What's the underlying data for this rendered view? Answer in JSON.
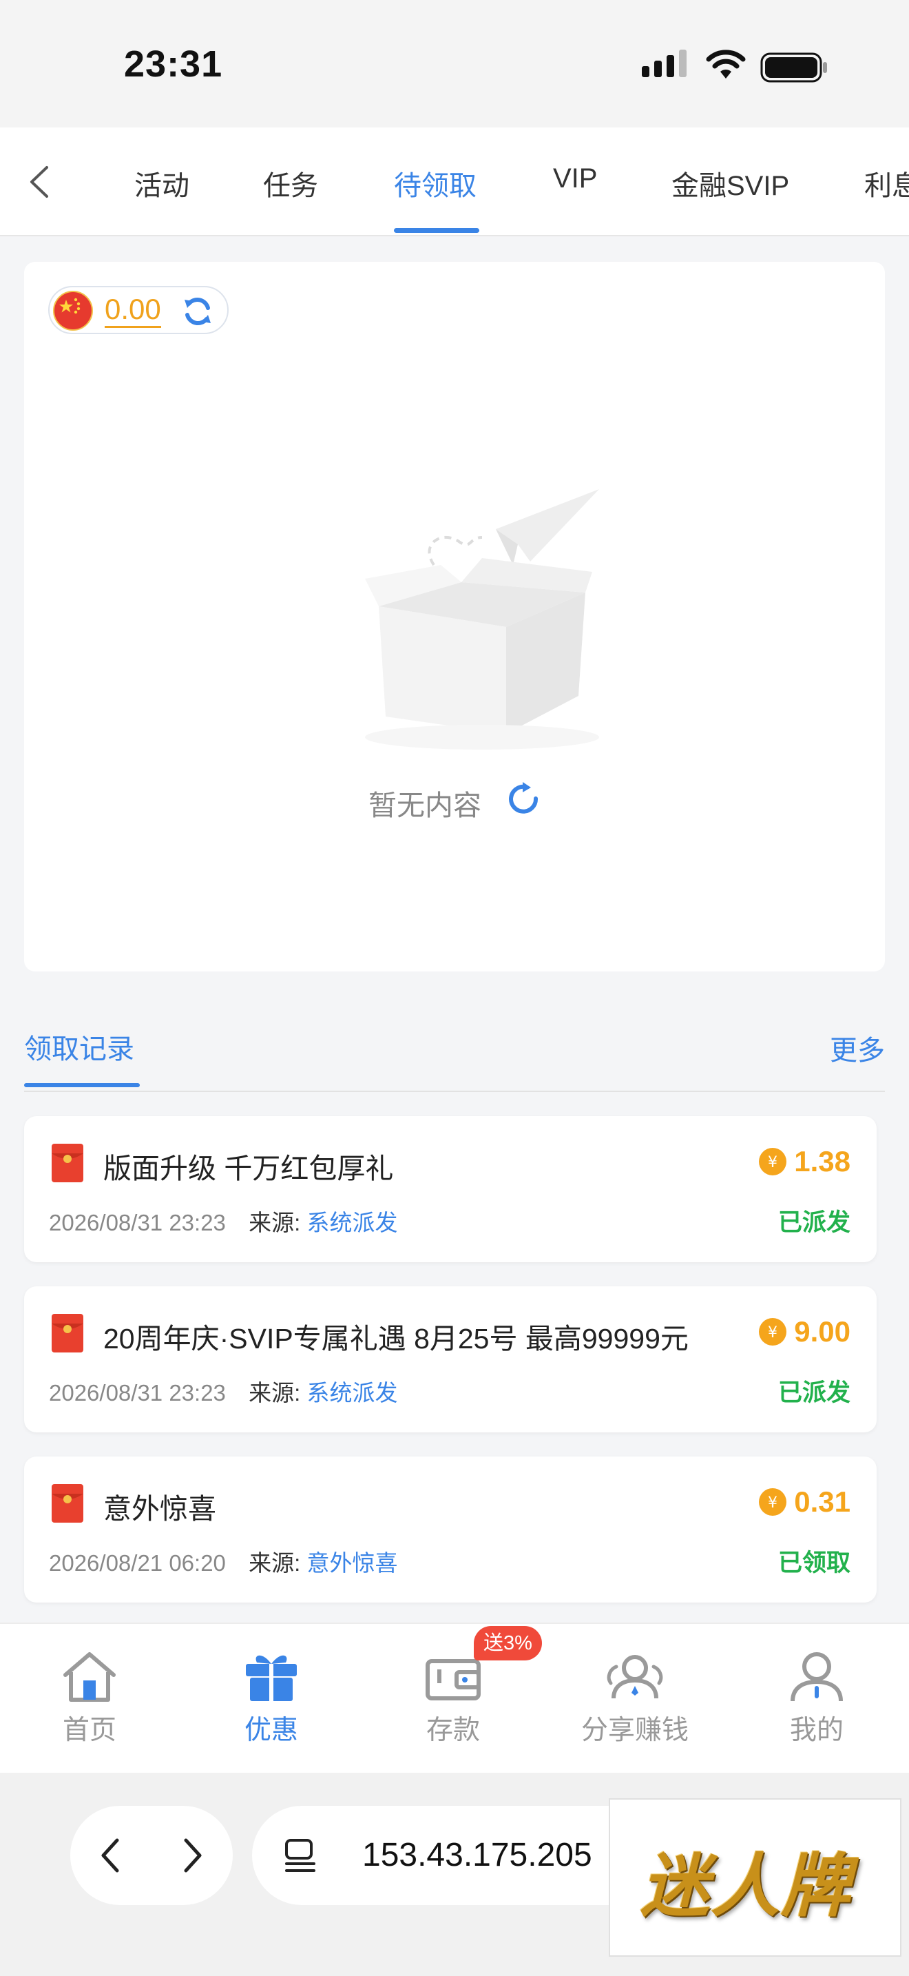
{
  "status_bar": {
    "time": "23:31"
  },
  "tabs": [
    {
      "label": "活动",
      "active": false
    },
    {
      "label": "任务",
      "active": false
    },
    {
      "label": "待领取",
      "active": true
    },
    {
      "label": "VIP",
      "active": false
    },
    {
      "label": "金融SVIP",
      "active": false
    },
    {
      "label": "利息",
      "active": false
    }
  ],
  "wallet": {
    "currency_flag": "china-flag-icon",
    "balance": "0.00"
  },
  "empty_state": {
    "text": "暂无内容"
  },
  "records_section": {
    "title": "领取记录",
    "more_label": "更多"
  },
  "records": [
    {
      "title": "版面升级 千万红包厚礼",
      "amount": "1.38",
      "datetime": "2026/08/31 23:23",
      "source_label": "来源:",
      "source": "系统派发",
      "status": "已派发"
    },
    {
      "title": "20周年庆·SVIP专属礼遇 8月25号 最高99999元",
      "amount": "9.00",
      "datetime": "2026/08/31 23:23",
      "source_label": "来源:",
      "source": "系统派发",
      "status": "已派发"
    },
    {
      "title": "意外惊喜",
      "amount": "0.31",
      "datetime": "2026/08/21 06:20",
      "source_label": "来源:",
      "source": "意外惊喜",
      "status": "已领取"
    }
  ],
  "bottom_nav": {
    "items": [
      {
        "label": "首页",
        "icon": "home-icon",
        "active": false
      },
      {
        "label": "优惠",
        "icon": "gift-icon",
        "active": true
      },
      {
        "label": "存款",
        "icon": "wallet-icon",
        "active": false
      },
      {
        "label": "分享赚钱",
        "icon": "share-people-icon",
        "active": false
      },
      {
        "label": "我的",
        "icon": "user-icon",
        "active": false
      }
    ],
    "deposit_badge": "送3%"
  },
  "browser": {
    "url": "153.43.175.205"
  },
  "brand_logo_text": "迷人牌",
  "colors": {
    "accent": "#3a84e6",
    "amount": "#f5a51c",
    "status_green": "#22b14c",
    "badge_red": "#f04a3a"
  }
}
